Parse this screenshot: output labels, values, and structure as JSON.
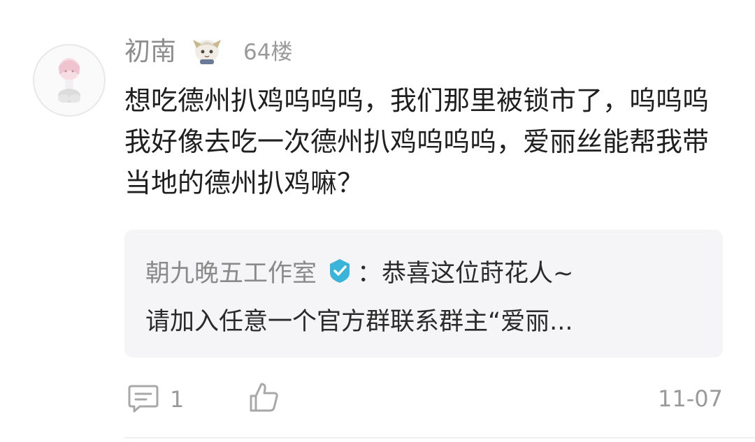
{
  "comment": {
    "username": "初南",
    "floor": "64楼",
    "body": "想吃德州扒鸡呜呜呜，我们那里被锁市了，呜呜呜我好像去吃一次德州扒鸡呜呜呜，爱丽丝能帮我带当地的德州扒鸡嘛？",
    "badge_icon": "character-badge-icon",
    "avatar_icon": "anime-avatar-icon"
  },
  "reply": {
    "author": "朝九晚五工作室",
    "verified_icon": "verified-check-icon",
    "verified_color": "#3ab4d9",
    "line1": "：恭喜这位莳花人~",
    "line2": "请加入任意一个官方群联系群主“爱丽..."
  },
  "actions": {
    "comment_icon": "comment-icon",
    "comment_count": "1",
    "like_icon": "thumbs-up-icon",
    "date": "11-07"
  }
}
